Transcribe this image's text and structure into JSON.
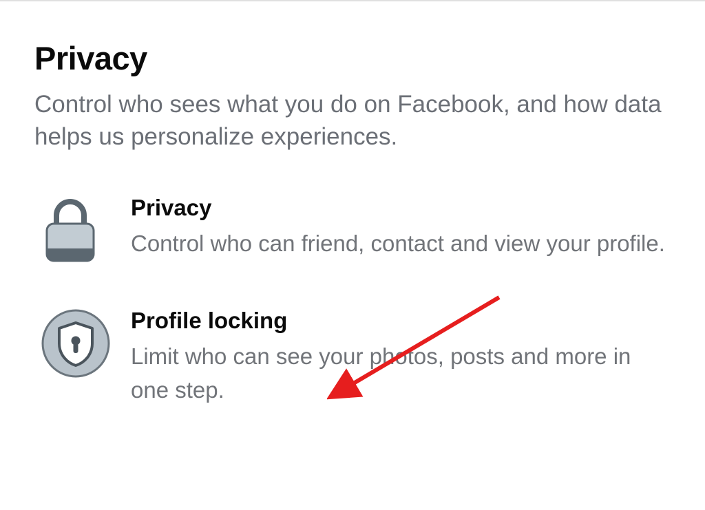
{
  "header": {
    "title": "Privacy",
    "subtitle": "Control who sees what you do on Facebook, and how data helps us personalize experiences."
  },
  "items": [
    {
      "icon": "lock-icon",
      "title": "Privacy",
      "description": "Control who can friend, contact and view your profile."
    },
    {
      "icon": "shield-lock-icon",
      "title": "Profile locking",
      "description": "Limit who can see your photos, posts and more in one step."
    }
  ],
  "annotation": {
    "type": "arrow",
    "color": "#e61e1e",
    "points_to": "Profile locking"
  }
}
